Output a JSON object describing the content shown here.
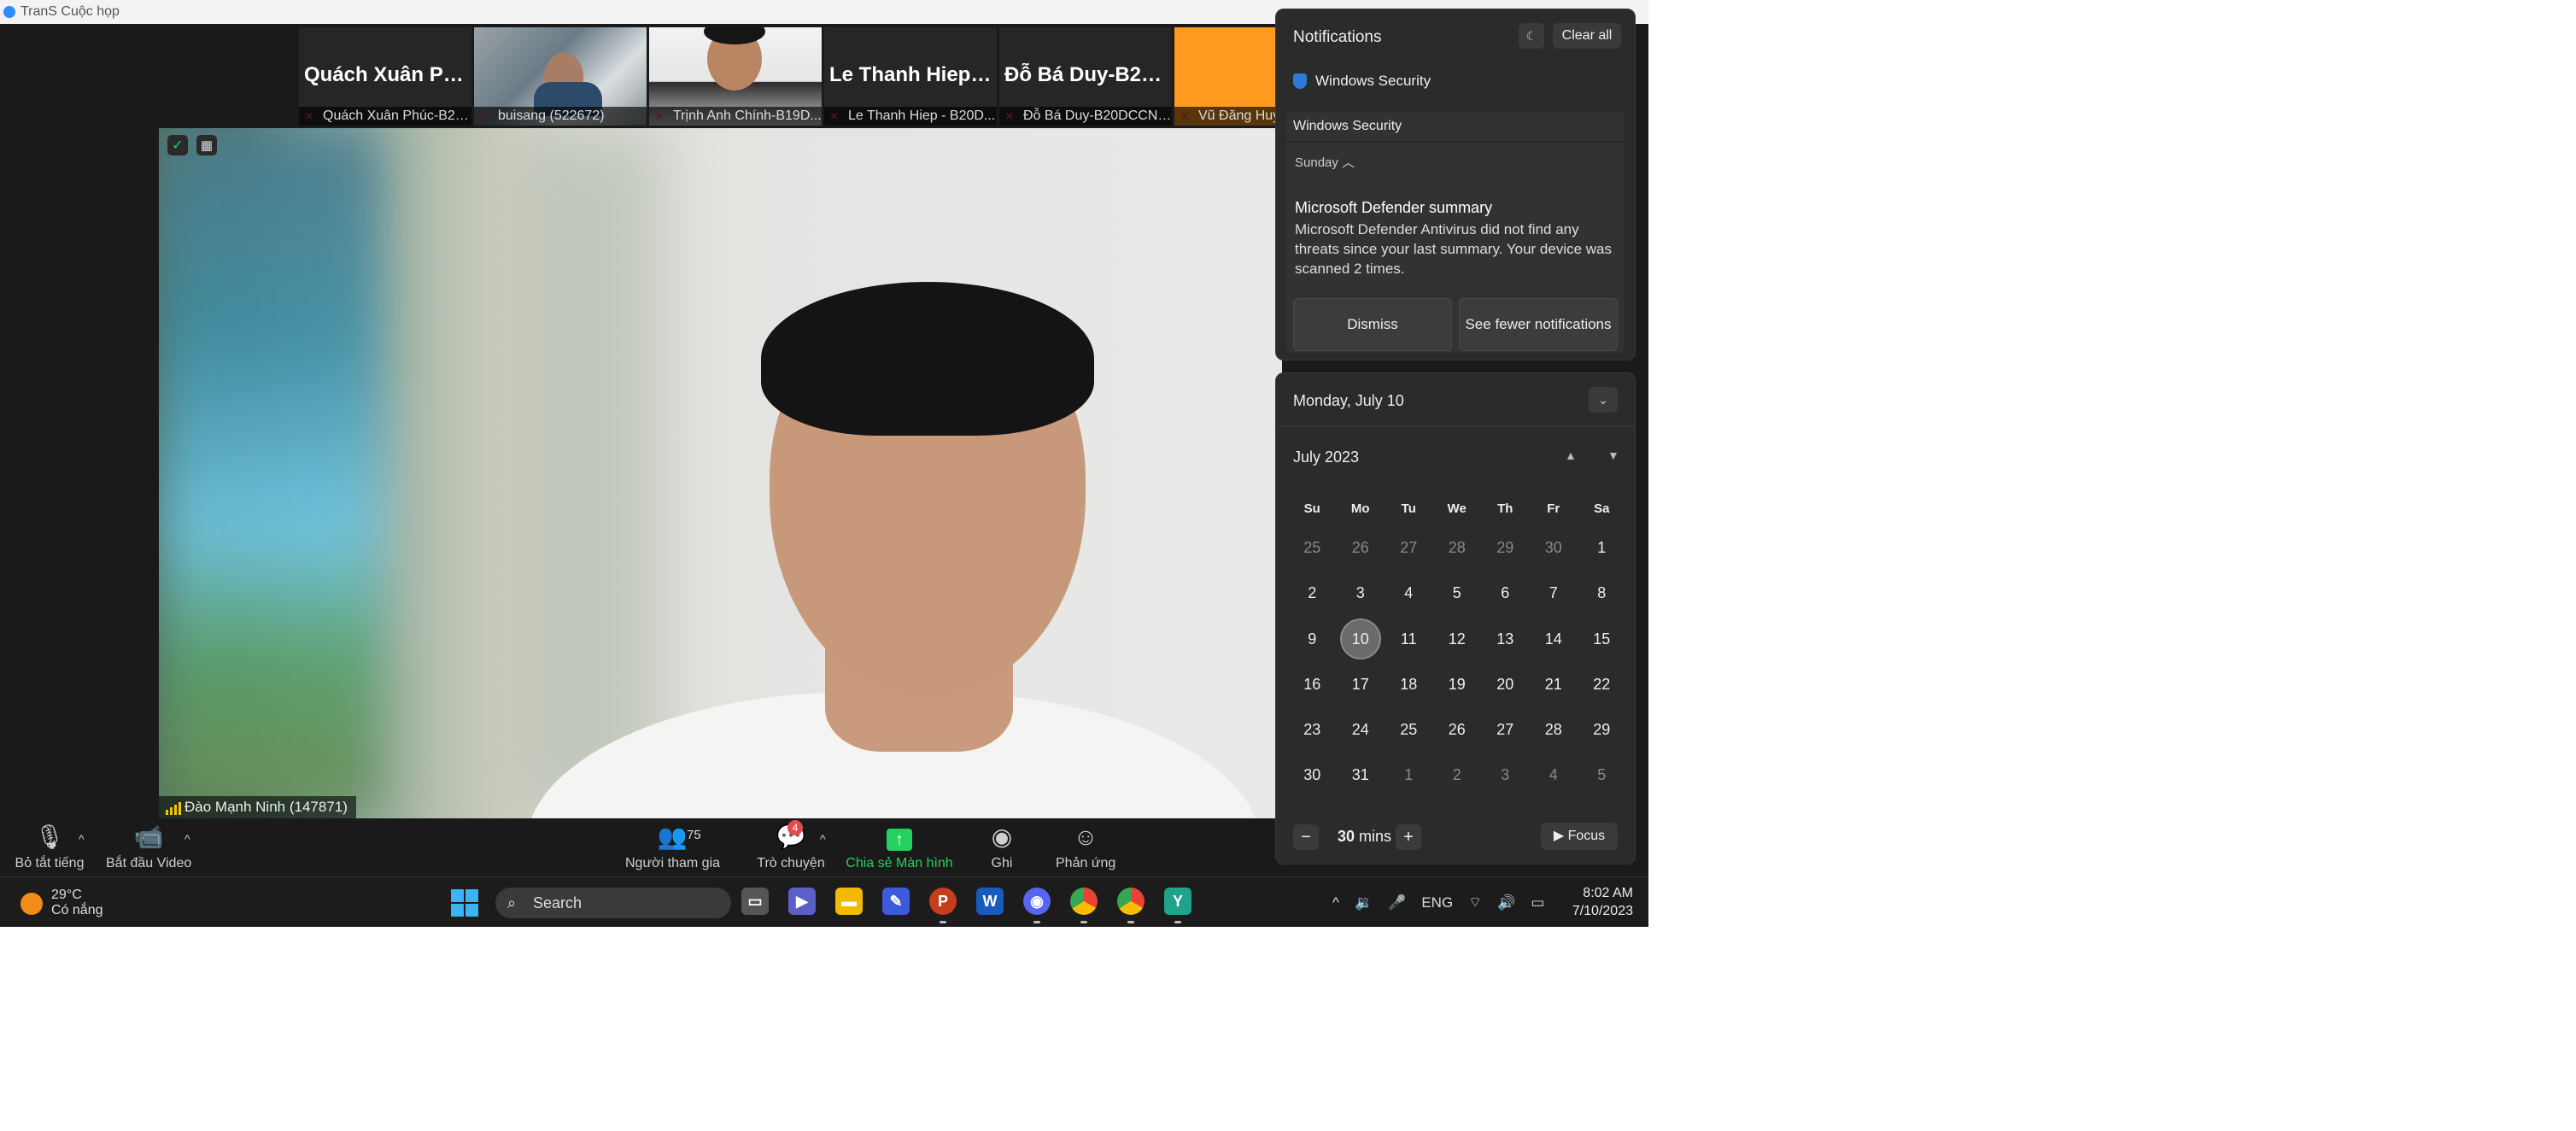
{
  "window": {
    "title": "TranS Cuộc họp"
  },
  "participants": [
    {
      "tile_name": "Quách Xuân  Ph...",
      "caption": "Quách Xuân  Phúc-B20..."
    },
    {
      "tile_name": "",
      "caption": "buisang (522672)"
    },
    {
      "tile_name": "",
      "caption": "Trịnh Anh Chính-B19D..."
    },
    {
      "tile_name": "Le Thanh Hiep -...",
      "caption": "Le Thanh Hiep - B20D..."
    },
    {
      "tile_name": "Đỗ Bá Duy-B20...",
      "caption": "Đỗ Bá Duy-B20DCCN1..."
    },
    {
      "tile_name": "",
      "caption": "Vũ Đăng Huy"
    }
  ],
  "speaker": {
    "caption": "Đào Mạnh Ninh (147871)"
  },
  "toolbar": {
    "mute": "Bỏ tắt tiếng",
    "video": "Bắt đầu Video",
    "participants": "Người tham gia",
    "participants_count": "75",
    "chat": "Trò chuyện",
    "chat_badge": "4",
    "share": "Chia sẻ Màn hình",
    "record": "Ghi",
    "reactions": "Phản ứng"
  },
  "taskbar": {
    "weather_temp": "29°C",
    "weather_desc": "Có nắng",
    "search": "Search",
    "language": "ENG",
    "time": "8:02 AM",
    "date": "7/10/2023"
  },
  "notifications": {
    "title": "Notifications",
    "clear_all": "Clear all",
    "source": "Windows Security",
    "group": "Windows Security",
    "day": "Sunday",
    "heading": "Microsoft Defender summary",
    "body": "Microsoft Defender Antivirus did not find any threats since your last summary. Your device was scanned 2 times.",
    "dismiss": "Dismiss",
    "see_fewer": "See fewer notifications"
  },
  "calendar": {
    "date_header": "Monday, July 10",
    "month": "July 2023",
    "weekdays": [
      "Su",
      "Mo",
      "Tu",
      "We",
      "Th",
      "Fr",
      "Sa"
    ],
    "days": [
      "25",
      "26",
      "27",
      "28",
      "29",
      "30",
      "1",
      "2",
      "3",
      "4",
      "5",
      "6",
      "7",
      "8",
      "9",
      "10",
      "11",
      "12",
      "13",
      "14",
      "15",
      "16",
      "17",
      "18",
      "19",
      "20",
      "21",
      "22",
      "23",
      "24",
      "25",
      "26",
      "27",
      "28",
      "29",
      "30",
      "31",
      "1",
      "2",
      "3",
      "4",
      "5"
    ],
    "today": "10",
    "focus_minutes": "30",
    "focus_unit": "mins",
    "focus_label": "Focus"
  }
}
